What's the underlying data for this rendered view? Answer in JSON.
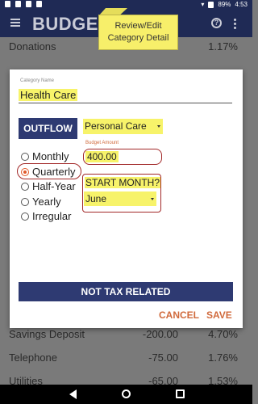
{
  "status_bar": {
    "battery": "89%",
    "time": "4:53"
  },
  "app_bar": {
    "title": "BUDGET"
  },
  "callout": {
    "line1": "Review/Edit",
    "line2": "Category Detail"
  },
  "background_list": {
    "top_row": {
      "name": "Donations",
      "percent": "1.17%"
    },
    "rows": [
      {
        "name": "Savings Deposit",
        "amount": "-200.00",
        "percent": "4.70%"
      },
      {
        "name": "Telephone",
        "amount": "-75.00",
        "percent": "1.76%"
      },
      {
        "name": "Utilities",
        "amount": "-65.00",
        "percent": "1.53%"
      }
    ]
  },
  "dialog": {
    "category_label": "Category Name",
    "category_value": "Health Care",
    "outflow_button": "OUTFLOW",
    "category_select": "Personal Care",
    "frequency_options": [
      "Monthly",
      "Quarterly",
      "Half-Year",
      "Yearly",
      "Irregular"
    ],
    "frequency_selected": "Quarterly",
    "budget_amount_label": "Budget Amount",
    "budget_amount_value": "400.00",
    "start_month_label": "START MONTH?",
    "start_month_value": "June",
    "tax_button": "NOT TAX RELATED",
    "cancel_button": "CANCEL",
    "save_button": "SAVE"
  },
  "colors": {
    "app_bar": "#1f2a55",
    "primary_button": "#2e3a72",
    "accent": "#d06a3c",
    "highlight": "#f7f36a",
    "annotation_ring": "#a22828"
  }
}
